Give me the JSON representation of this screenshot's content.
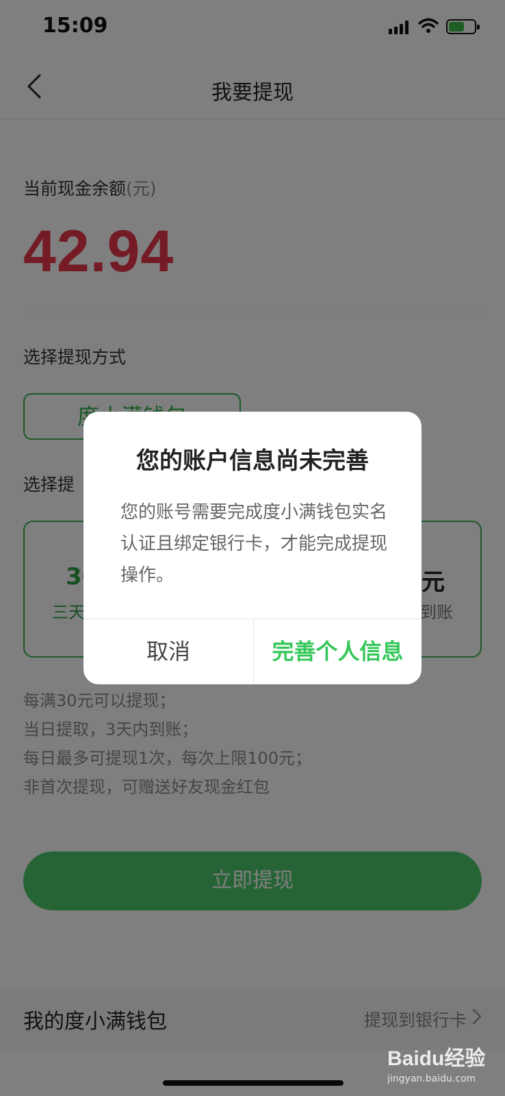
{
  "status_bar": {
    "time": "15:09"
  },
  "nav": {
    "title": "我要提现"
  },
  "balance": {
    "label": "当前现金余额",
    "unit": "(元)",
    "amount": "42.94"
  },
  "method": {
    "label": "选择提现方式",
    "option": "度小满钱包"
  },
  "amount_section": {
    "label": "选择提",
    "left_value": "30",
    "left_desc": "三天",
    "right_value": "元",
    "right_desc": "到账"
  },
  "rules": [
    "每满30元可以提现；",
    "当日提取，3天内到账；",
    "每日最多可提现1次，每次上限100元；",
    "非首次提现，可赠送好友现金红包"
  ],
  "withdraw_button": "立即提现",
  "bottom_bar": {
    "left": "我的度小满钱包",
    "right": "提现到银行卡"
  },
  "dialog": {
    "title": "您的账户信息尚未完善",
    "message": "您的账号需要完成度小满钱包实名认证且绑定银行卡，才能完成提现操作。",
    "cancel": "取消",
    "confirm": "完善个人信息"
  },
  "watermark": {
    "brand": "Baidu经验",
    "url": "jingyan.baidu.com"
  },
  "colors": {
    "accent_green": "#37b24d",
    "balance_red": "#e8374b",
    "confirm_green": "#34c759"
  }
}
